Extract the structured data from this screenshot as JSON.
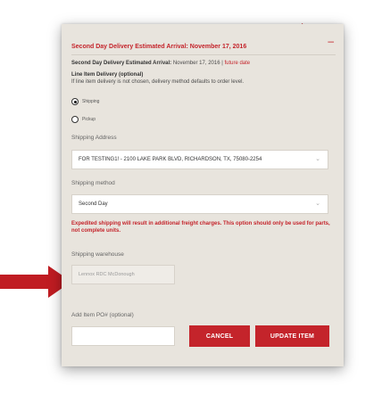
{
  "header": {
    "title": "Second Day Delivery Estimated Arrival:  November 17, 2016",
    "collapse_symbol": "–"
  },
  "estimate": {
    "label": "Second Day Delivery Estimated Arrival:",
    "date": " November 17, 2016 | ",
    "future_link": "future date"
  },
  "line_item": {
    "title": "Line Item Delivery (optional)",
    "hint": "If line item delivery is not chosen, delivery method defaults to order level."
  },
  "delivery_options": {
    "shipping": "Shipping",
    "pickup": "Pickup",
    "selected": "Shipping"
  },
  "shipping_address": {
    "label": "Shipping Address",
    "value": "FOR TESTING1! - 2100 LAKE PARK BLVD, RICHARDSON, TX, 75080-2254"
  },
  "shipping_method": {
    "label": "Shipping method",
    "value": "Second Day"
  },
  "warning": "Expedited shipping will result in additional freight charges. This option should only be used for parts, not complete units.",
  "warehouse": {
    "label": "Shipping warehouse",
    "value": "Lennox RDC McDonough"
  },
  "po": {
    "label": "Add Item PO# (optional)",
    "value": ""
  },
  "buttons": {
    "cancel": "CANCEL",
    "update": "UPDATE ITEM"
  },
  "colors": {
    "accent": "#c4242b",
    "panel": "#e8e4dd"
  }
}
